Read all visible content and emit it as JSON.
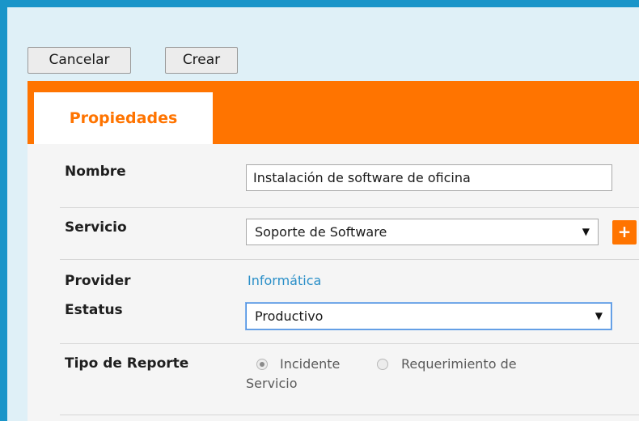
{
  "toolbar": {
    "cancel_label": "Cancelar",
    "create_label": "Crear"
  },
  "tabs": [
    {
      "label": "Propiedades",
      "active": true
    }
  ],
  "form": {
    "nombre": {
      "label": "Nombre",
      "value": "Instalación de software de oficina"
    },
    "servicio": {
      "label": "Servicio",
      "value": "Soporte de Software",
      "arrow": "▼",
      "add_label": "+"
    },
    "provider": {
      "label": "Provider",
      "value": "Informática"
    },
    "estatus": {
      "label": "Estatus",
      "value": "Productivo",
      "arrow": "▼"
    },
    "tipo_reporte": {
      "label": "Tipo de Reporte",
      "options": [
        {
          "label": "Incidente",
          "selected": true
        },
        {
          "label": "Requerimiento de",
          "selected": false
        }
      ],
      "wrap": "Servicio"
    }
  },
  "colors": {
    "frame": "#1a95c9",
    "accent": "#ff7400",
    "link": "#2a8fc8"
  }
}
